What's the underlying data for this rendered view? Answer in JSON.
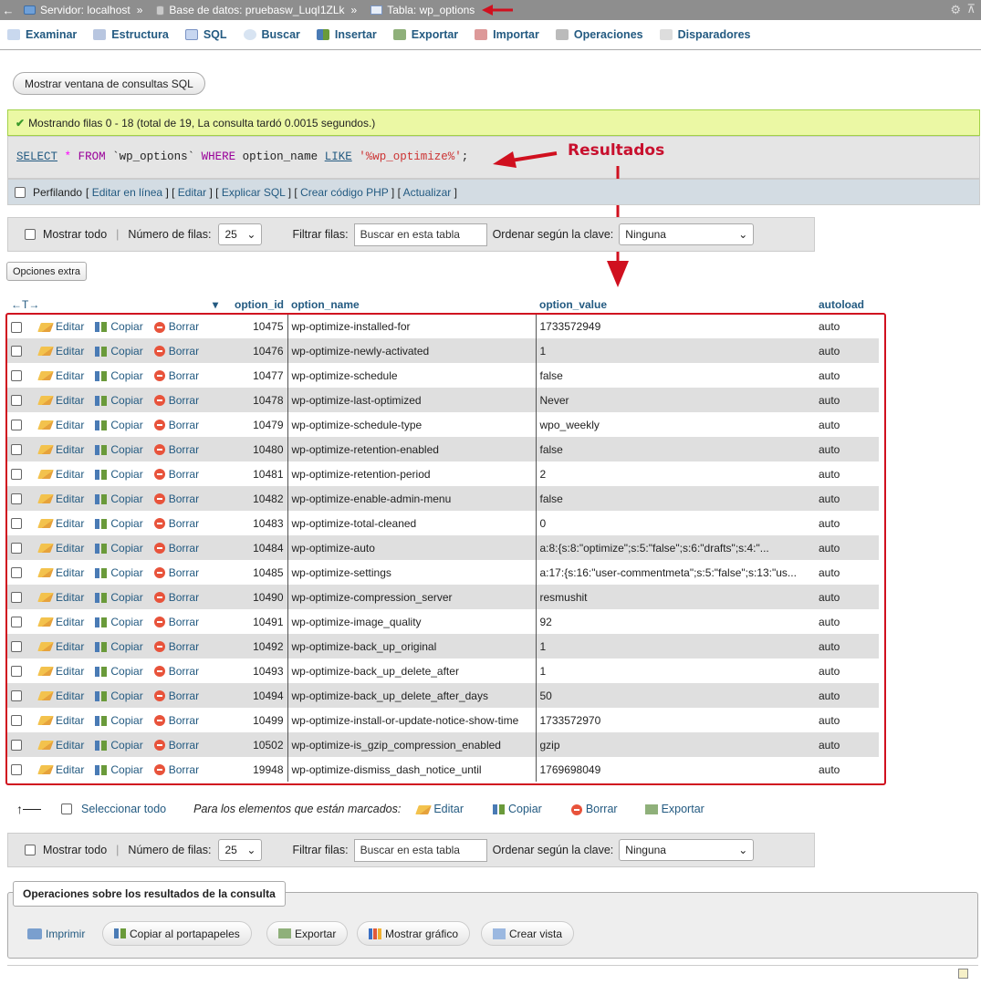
{
  "breadcrumb": {
    "server": "Servidor: localhost",
    "database": "Base de datos: pruebasw_LuqI1ZLk",
    "table": "Tabla: wp_options"
  },
  "tabs": [
    "Examinar",
    "Estructura",
    "SQL",
    "Buscar",
    "Insertar",
    "Exportar",
    "Importar",
    "Operaciones",
    "Disparadores"
  ],
  "sql_window_button": "Mostrar ventana de consultas SQL",
  "success_msg": "Mostrando filas 0 - 18 (total de 19, La consulta tardó 0.0015 segundos.)",
  "query": {
    "select": "SELECT",
    "star": "*",
    "from": "FROM",
    "table": "`wp_options`",
    "where": "WHERE",
    "col": "option_name",
    "like": "LIKE",
    "pattern": "'%wp_optimize%'",
    "end": ";"
  },
  "profiling": {
    "label": "Perfilando",
    "links": [
      "Editar en línea",
      "Editar",
      "Explicar SQL",
      "Crear código PHP",
      "Actualizar"
    ]
  },
  "nav": {
    "show_all": "Mostrar todo",
    "rows_label": "Número de filas:",
    "rows_value": "25",
    "filter_label": "Filtrar filas:",
    "filter_placeholder": "Buscar en esta tabla",
    "sort_label": "Ordenar según la clave:",
    "sort_value": "Ninguna"
  },
  "extra_options": "Opciones extra",
  "columns": {
    "id": "option_id",
    "name": "option_name",
    "value": "option_value",
    "autoload": "autoload"
  },
  "actions": {
    "edit": "Editar",
    "copy": "Copiar",
    "delete": "Borrar"
  },
  "rows": [
    [
      "10475",
      "wp-optimize-installed-for",
      "1733572949",
      "auto"
    ],
    [
      "10476",
      "wp-optimize-newly-activated",
      "1",
      "auto"
    ],
    [
      "10477",
      "wp-optimize-schedule",
      "false",
      "auto"
    ],
    [
      "10478",
      "wp-optimize-last-optimized",
      "Never",
      "auto"
    ],
    [
      "10479",
      "wp-optimize-schedule-type",
      "wpo_weekly",
      "auto"
    ],
    [
      "10480",
      "wp-optimize-retention-enabled",
      "false",
      "auto"
    ],
    [
      "10481",
      "wp-optimize-retention-period",
      "2",
      "auto"
    ],
    [
      "10482",
      "wp-optimize-enable-admin-menu",
      "false",
      "auto"
    ],
    [
      "10483",
      "wp-optimize-total-cleaned",
      "0",
      "auto"
    ],
    [
      "10484",
      "wp-optimize-auto",
      "a:8:{s:8:\"optimize\";s:5:\"false\";s:6:\"drafts\";s:4:\"...",
      "auto"
    ],
    [
      "10485",
      "wp-optimize-settings",
      "a:17:{s:16:\"user-commentmeta\";s:5:\"false\";s:13:\"us...",
      "auto"
    ],
    [
      "10490",
      "wp-optimize-compression_server",
      "resmushit",
      "auto"
    ],
    [
      "10491",
      "wp-optimize-image_quality",
      "92",
      "auto"
    ],
    [
      "10492",
      "wp-optimize-back_up_original",
      "1",
      "auto"
    ],
    [
      "10493",
      "wp-optimize-back_up_delete_after",
      "1",
      "auto"
    ],
    [
      "10494",
      "wp-optimize-back_up_delete_after_days",
      "50",
      "auto"
    ],
    [
      "10499",
      "wp-optimize-install-or-update-notice-show-time",
      "1733572970",
      "auto"
    ],
    [
      "10502",
      "wp-optimize-is_gzip_compression_enabled",
      "gzip",
      "auto"
    ],
    [
      "19948",
      "wp-optimize-dismiss_dash_notice_until",
      "1769698049",
      "auto"
    ]
  ],
  "bulk": {
    "select_all": "Seleccionar todo",
    "marked_label": "Para los elementos que están marcados:",
    "edit": "Editar",
    "copy": "Copiar",
    "delete": "Borrar",
    "export": "Exportar"
  },
  "query_ops": {
    "title": "Operaciones sobre los resultados de la consulta",
    "print": "Imprimir",
    "copy_clipboard": "Copiar al portapapeles",
    "export": "Exportar",
    "chart": "Mostrar gráfico",
    "create_view": "Crear vista"
  },
  "annotation": "Resultados",
  "colors": {
    "link": "#235a81",
    "annotation": "#d0101f",
    "success_bg": "#ebf8a4"
  }
}
